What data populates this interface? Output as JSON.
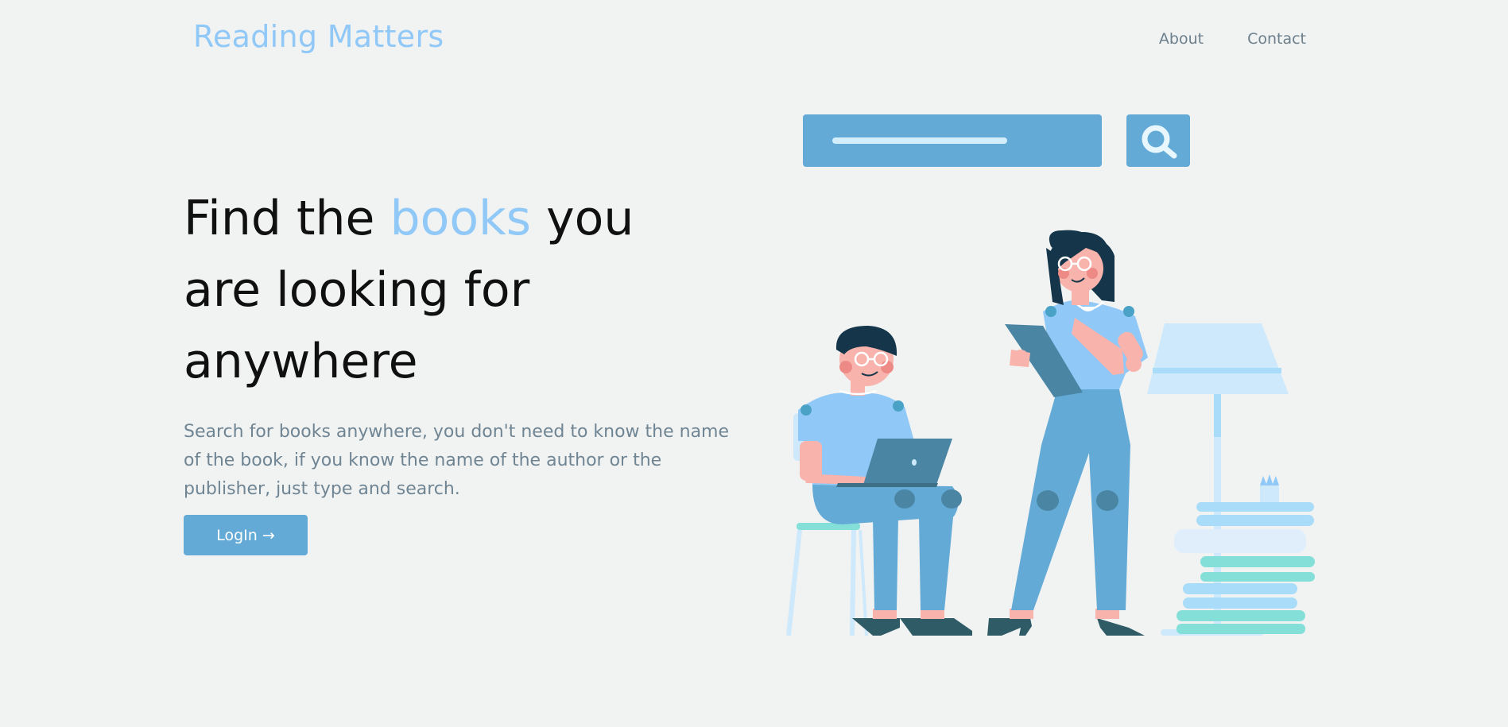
{
  "header": {
    "brand": "Reading Matters",
    "nav": [
      {
        "label": "About"
      },
      {
        "label": "Contact"
      }
    ]
  },
  "hero": {
    "title_part1": "Find the ",
    "title_accent": "books",
    "title_part2": " you are looking for anywhere",
    "description": "Search for books anywhere, you don't need to know the name of the book, if you know the name of the author or the publisher, just type and search.",
    "login_label": "LogIn →"
  },
  "colors": {
    "background": "#f1f2f2",
    "accent": "#90c8f8",
    "button": "#63aad6",
    "text_muted": "#6f8593"
  },
  "icons": [
    "search-icon"
  ]
}
